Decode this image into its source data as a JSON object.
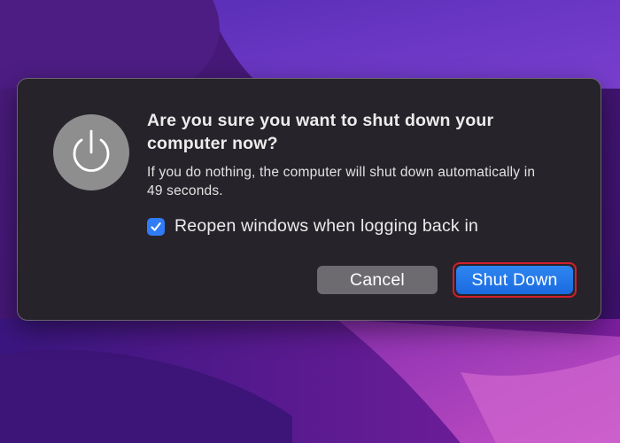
{
  "dialog": {
    "title": "Are you sure you want to shut down your computer now?",
    "message": "If you do nothing, the computer will shut down automatically in 49 seconds.",
    "icon": "power-icon",
    "checkbox": {
      "label": "Reopen windows when logging back in",
      "checked": true
    },
    "buttons": {
      "cancel_label": "Cancel",
      "shutdown_label": "Shut Down"
    }
  },
  "colors": {
    "accent": "#2f7cf6",
    "highlight_ring": "#d21f2c",
    "dialog_background": "#27232a"
  }
}
